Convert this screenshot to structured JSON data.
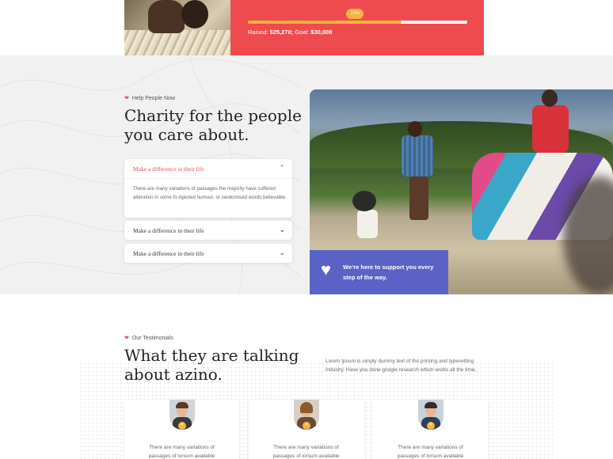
{
  "campaign": {
    "progress_label": "70%",
    "progress_value": 0.7,
    "raised_prefix": "Raised:",
    "raised_amount": "$25,270;",
    "goal_prefix": "Goal:",
    "goal_amount": "$30,000",
    "accent_color": "#ee4b4e",
    "progress_color": "#f6b43c"
  },
  "help": {
    "eyebrow": "Help People Now",
    "title_line1": "Charity for the people",
    "title_line2": "you care about.",
    "accordion": [
      {
        "title": "Make a difference in their life",
        "expanded": true,
        "body": "There are many variations of passages the majority have suffered alteration in some fo injected humour, or randomised words believable."
      },
      {
        "title": "Make a difference in their life",
        "expanded": false
      },
      {
        "title": "Make a difference in their life",
        "expanded": false
      }
    ],
    "support_text": "We’re here to support you every step of the way.",
    "support_color": "#5b62c6"
  },
  "testimonials": {
    "eyebrow": "Our Testimonials",
    "title_line1": "What they are talking",
    "title_line2": "about azino.",
    "intro": "Lorem Ipsum is simply dummy text of the printing and typesetting industry. Have you done google research which works all the time.",
    "cards": [
      {
        "text_line1": "There are many variations of",
        "text_line2": "passages of lorsum available"
      },
      {
        "text_line1": "There are many variations of",
        "text_line2": "passages of lorsum available"
      },
      {
        "text_line1": "There are many variations of",
        "text_line2": "passages of lorsum available"
      }
    ]
  }
}
